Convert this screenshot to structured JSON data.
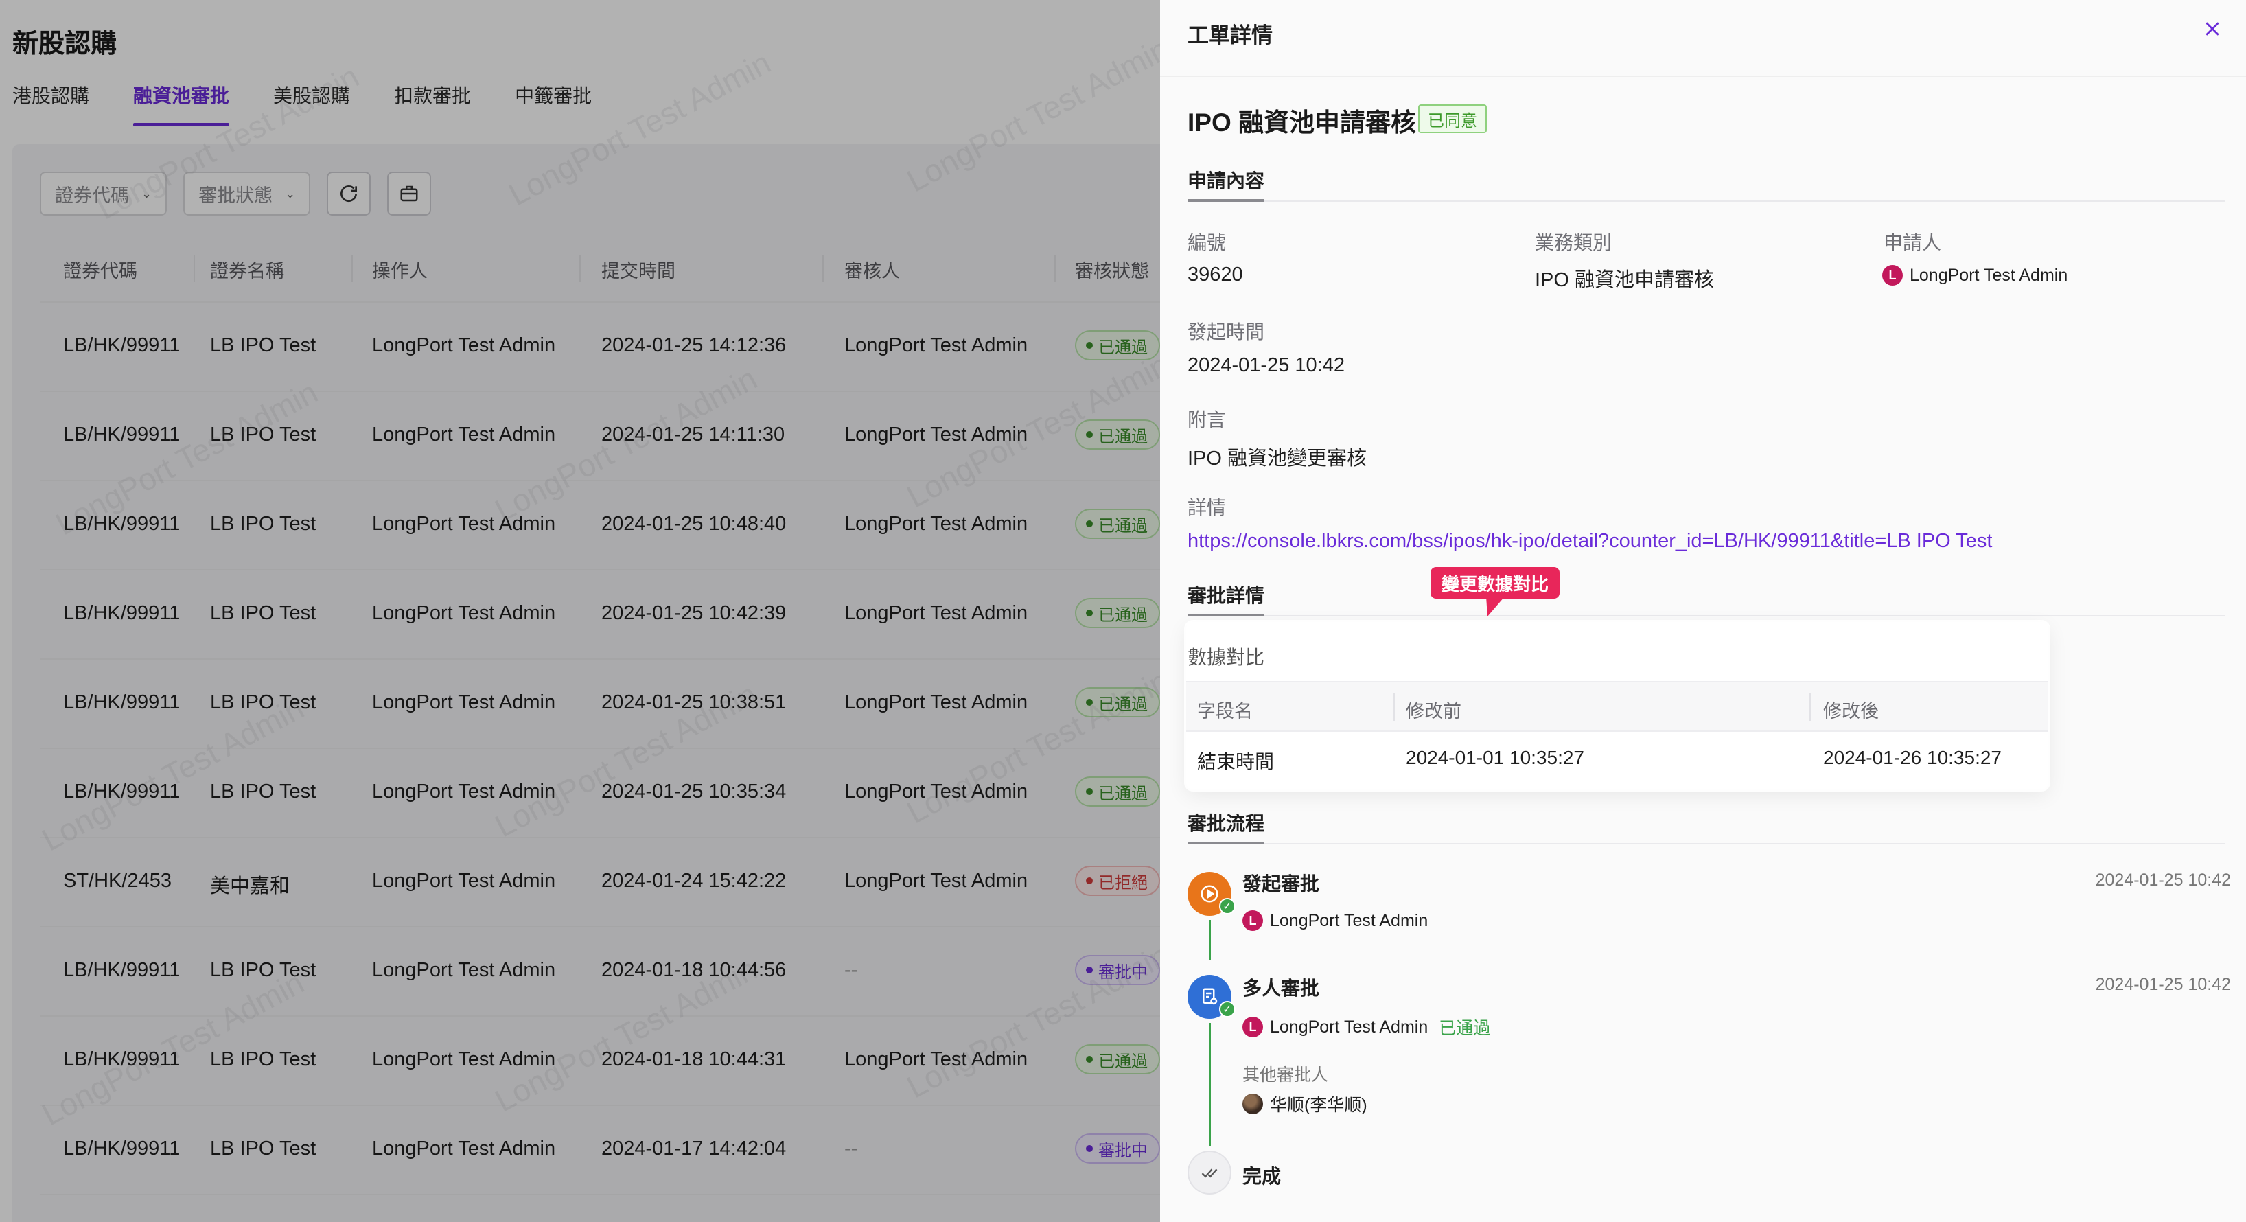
{
  "page": {
    "title": "新股認購",
    "tabs": [
      {
        "label": "港股認購",
        "active": false
      },
      {
        "label": "融資池審批",
        "active": true
      },
      {
        "label": "美股認購",
        "active": false
      },
      {
        "label": "扣款審批",
        "active": false
      },
      {
        "label": "中籤審批",
        "active": false
      }
    ],
    "filters": {
      "code_placeholder": "證券代碼",
      "status_placeholder": "審批狀態"
    },
    "watermark": "LongPort Test Admin",
    "columns": [
      "證券代碼",
      "證券名稱",
      "操作人",
      "提交時間",
      "審核人",
      "審核狀態"
    ],
    "rows": [
      {
        "code": "LB/HK/99911",
        "name": "LB IPO Test",
        "operator": "LongPort Test Admin",
        "time": "2024-01-25 14:12:36",
        "reviewer": "LongPort Test Admin",
        "status": "已通過",
        "kind": "passed"
      },
      {
        "code": "LB/HK/99911",
        "name": "LB IPO Test",
        "operator": "LongPort Test Admin",
        "time": "2024-01-25 14:11:30",
        "reviewer": "LongPort Test Admin",
        "status": "已通過",
        "kind": "passed"
      },
      {
        "code": "LB/HK/99911",
        "name": "LB IPO Test",
        "operator": "LongPort Test Admin",
        "time": "2024-01-25 10:48:40",
        "reviewer": "LongPort Test Admin",
        "status": "已通過",
        "kind": "passed"
      },
      {
        "code": "LB/HK/99911",
        "name": "LB IPO Test",
        "operator": "LongPort Test Admin",
        "time": "2024-01-25 10:42:39",
        "reviewer": "LongPort Test Admin",
        "status": "已通過",
        "kind": "passed"
      },
      {
        "code": "LB/HK/99911",
        "name": "LB IPO Test",
        "operator": "LongPort Test Admin",
        "time": "2024-01-25 10:38:51",
        "reviewer": "LongPort Test Admin",
        "status": "已通過",
        "kind": "passed"
      },
      {
        "code": "LB/HK/99911",
        "name": "LB IPO Test",
        "operator": "LongPort Test Admin",
        "time": "2024-01-25 10:35:34",
        "reviewer": "LongPort Test Admin",
        "status": "已通過",
        "kind": "passed"
      },
      {
        "code": "ST/HK/2453",
        "name": "美中嘉和",
        "operator": "LongPort Test Admin",
        "time": "2024-01-24 15:42:22",
        "reviewer": "LongPort Test Admin",
        "status": "已拒絕",
        "kind": "rejected"
      },
      {
        "code": "LB/HK/99911",
        "name": "LB IPO Test",
        "operator": "LongPort Test Admin",
        "time": "2024-01-18 10:44:56",
        "reviewer": "--",
        "status": "審批中",
        "kind": "pending"
      },
      {
        "code": "LB/HK/99911",
        "name": "LB IPO Test",
        "operator": "LongPort Test Admin",
        "time": "2024-01-18 10:44:31",
        "reviewer": "LongPort Test Admin",
        "status": "已通過",
        "kind": "passed"
      },
      {
        "code": "LB/HK/99911",
        "name": "LB IPO Test",
        "operator": "LongPort Test Admin",
        "time": "2024-01-17 14:42:04",
        "reviewer": "--",
        "status": "審批中",
        "kind": "pending"
      }
    ]
  },
  "drawer": {
    "title": "工單詳情",
    "ticket_title": "IPO 融資池申請審核",
    "ticket_status": "已同意",
    "sections": {
      "content": "申請內容",
      "approval_detail": "審批詳情",
      "approval_flow": "審批流程"
    },
    "fields": {
      "number_label": "編號",
      "number": "39620",
      "business_label": "業務類別",
      "business": "IPO 融資池申請審核",
      "applicant_label": "申請人",
      "applicant": "LongPort Test Admin",
      "initiated_label": "發起時間",
      "initiated": "2024-01-25 10:42",
      "note_label": "附言",
      "note": "IPO 融資池變更審核",
      "detail_label": "詳情",
      "detail_url": "https://console.lbkrs.com/bss/ipos/hk-ipo/detail?counter_id=LB/HK/99911&title=LB IPO Test"
    },
    "callout": "變更數據對比",
    "compare": {
      "title": "數據對比",
      "headers": [
        "字段名",
        "修改前",
        "修改後"
      ],
      "row": {
        "field": "結束時間",
        "before": "2024-01-01 10:35:27",
        "after": "2024-01-26 10:35:27"
      }
    },
    "flow": [
      {
        "name": "發起審批",
        "time": "2024-01-25 10:42",
        "user": "LongPort Test Admin"
      },
      {
        "name": "多人審批",
        "time": "2024-01-25 10:42",
        "user": "LongPort Test Admin",
        "result": "已通過",
        "other_label": "其他審批人",
        "other_user": "华顺(李华顺)"
      },
      {
        "name": "完成"
      }
    ],
    "avatar_letter": "L"
  },
  "colors": {
    "accent": "#6a2bd9",
    "success": "#3aa34a",
    "danger": "#d23b3b",
    "callout": "#e8265a"
  }
}
